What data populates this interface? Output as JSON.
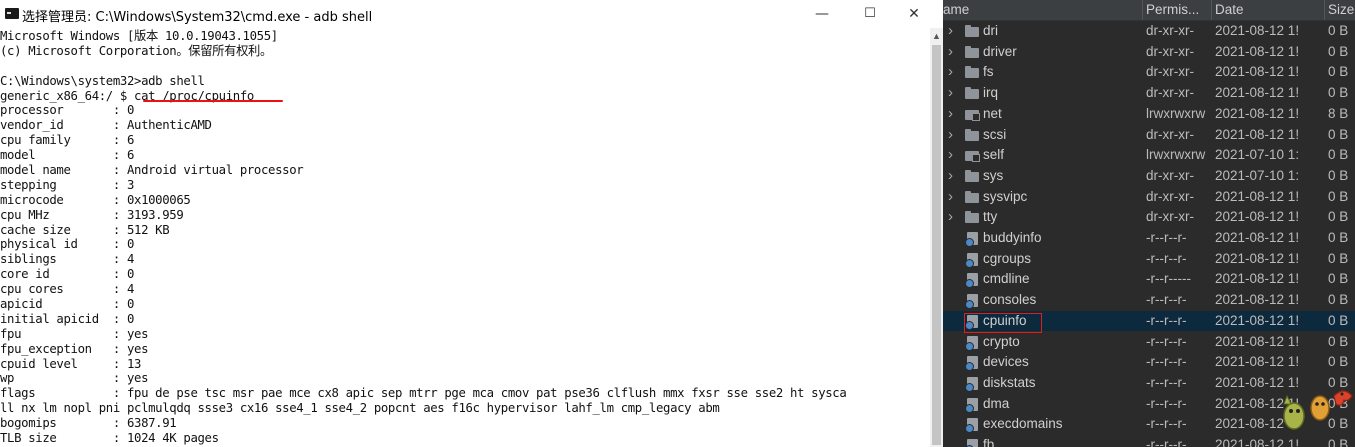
{
  "cmd": {
    "title": "选择管理员: C:\\Windows\\System32\\cmd.exe - adb  shell",
    "controls": {
      "minimize": "—",
      "maximize": "☐",
      "close": "✕"
    },
    "lines": [
      "Microsoft Windows [版本 10.0.19043.1055]",
      "(c) Microsoft Corporation。保留所有权利。",
      "",
      "C:\\Windows\\system32>adb shell",
      "generic_x86_64:/ $ cat /proc/cpuinfo",
      "processor       : 0",
      "vendor_id       : AuthenticAMD",
      "cpu family      : 6",
      "model           : 6",
      "model name      : Android virtual processor",
      "stepping        : 3",
      "microcode       : 0x1000065",
      "cpu MHz         : 3193.959",
      "cache size      : 512 KB",
      "physical id     : 0",
      "siblings        : 4",
      "core id         : 0",
      "cpu cores       : 4",
      "apicid          : 0",
      "initial apicid  : 0",
      "fpu             : yes",
      "fpu_exception   : yes",
      "cpuid level     : 13",
      "wp              : yes",
      "flags           : fpu de pse tsc msr pae mce cx8 apic sep mtrr pge mca cmov pat pse36 clflush mmx fxsr sse sse2 ht sysca",
      "ll nx lm nopl pni pclmulqdq ssse3 cx16 sse4_1 sse4_2 popcnt aes f16c hypervisor lahf_lm cmp_legacy abm",
      "bogomips        : 6387.91",
      "TLB size        : 1024 4K pages"
    ]
  },
  "explorer": {
    "columns": {
      "name": "ame",
      "permissions": "Permis...",
      "date": "Date",
      "size": "Size"
    },
    "rows": [
      {
        "type": "folder",
        "expandable": true,
        "name": "dri",
        "perm": "dr-xr-xr-",
        "date": "2021-08-12 1!",
        "size": "0 B"
      },
      {
        "type": "folder",
        "expandable": true,
        "name": "driver",
        "perm": "dr-xr-xr-",
        "date": "2021-08-12 1!",
        "size": "0 B"
      },
      {
        "type": "folder",
        "expandable": true,
        "name": "fs",
        "perm": "dr-xr-xr-",
        "date": "2021-08-12 1!",
        "size": "0 B"
      },
      {
        "type": "folder",
        "expandable": true,
        "name": "irq",
        "perm": "dr-xr-xr-",
        "date": "2021-08-12 1!",
        "size": "0 B"
      },
      {
        "type": "link",
        "expandable": true,
        "name": "net",
        "perm": "lrwxrwxrw",
        "date": "2021-08-12 1!",
        "size": "8 B"
      },
      {
        "type": "folder",
        "expandable": true,
        "name": "scsi",
        "perm": "dr-xr-xr-",
        "date": "2021-08-12 1!",
        "size": "0 B"
      },
      {
        "type": "link",
        "expandable": true,
        "name": "self",
        "perm": "lrwxrwxrw",
        "date": "2021-07-10 1:",
        "size": "0 B"
      },
      {
        "type": "folder",
        "expandable": true,
        "name": "sys",
        "perm": "dr-xr-xr-",
        "date": "2021-07-10 1:",
        "size": "0 B"
      },
      {
        "type": "folder",
        "expandable": true,
        "name": "sysvipc",
        "perm": "dr-xr-xr-",
        "date": "2021-08-12 1!",
        "size": "0 B"
      },
      {
        "type": "folder",
        "expandable": true,
        "name": "tty",
        "perm": "dr-xr-xr-",
        "date": "2021-08-12 1!",
        "size": "0 B"
      },
      {
        "type": "file",
        "expandable": false,
        "name": "buddyinfo",
        "perm": "-r--r--r-",
        "date": "2021-08-12 1!",
        "size": "0 B"
      },
      {
        "type": "file",
        "expandable": false,
        "name": "cgroups",
        "perm": "-r--r--r-",
        "date": "2021-08-12 1!",
        "size": "0 B"
      },
      {
        "type": "file",
        "expandable": false,
        "name": "cmdline",
        "perm": "-r--r-----",
        "date": "2021-08-12 1!",
        "size": "0 B"
      },
      {
        "type": "file",
        "expandable": false,
        "name": "consoles",
        "perm": "-r--r--r-",
        "date": "2021-08-12 1!",
        "size": "0 B"
      },
      {
        "type": "file",
        "expandable": false,
        "name": "cpuinfo",
        "perm": "-r--r--r-",
        "date": "2021-08-12 1!",
        "size": "0 B",
        "selected": true
      },
      {
        "type": "file",
        "expandable": false,
        "name": "crypto",
        "perm": "-r--r--r-",
        "date": "2021-08-12 1!",
        "size": "0 B"
      },
      {
        "type": "file",
        "expandable": false,
        "name": "devices",
        "perm": "-r--r--r-",
        "date": "2021-08-12 1!",
        "size": "0 B"
      },
      {
        "type": "file",
        "expandable": false,
        "name": "diskstats",
        "perm": "-r--r--r-",
        "date": "2021-08-12 1!",
        "size": "0 B"
      },
      {
        "type": "file",
        "expandable": false,
        "name": "dma",
        "perm": "-r--r--r-",
        "date": "2021-08-12 1!",
        "size": "0 B"
      },
      {
        "type": "file",
        "expandable": false,
        "name": "execdomains",
        "perm": "-r--r--r-",
        "date": "2021-08-12 1!",
        "size": "0 B"
      },
      {
        "type": "file",
        "expandable": false,
        "name": "fb",
        "perm": "-r--r--r-",
        "date": "2021-08-12 1!",
        "size": "0 B"
      }
    ]
  },
  "colors": {
    "explorer_bg": "#2b2b2b",
    "selection_bg": "#0d293e",
    "highlight_red": "#e21b1b"
  }
}
